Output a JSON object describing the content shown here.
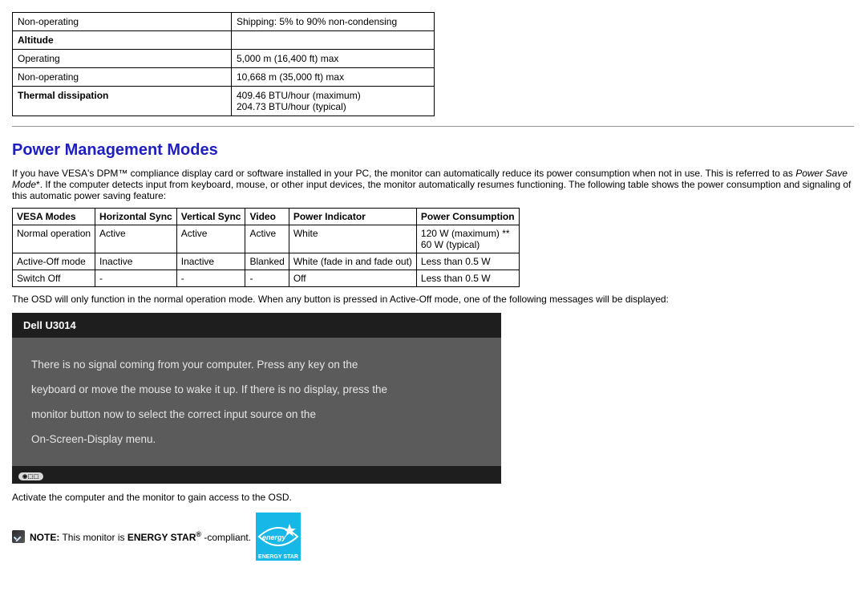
{
  "spec_table": {
    "rows": [
      {
        "label": "Non-operating",
        "value": "Shipping: 5% to 90% non-condensing",
        "boldLabel": false
      },
      {
        "label": "Altitude",
        "value": "",
        "boldLabel": true
      },
      {
        "label": "Operating",
        "value": "5,000 m (16,400 ft) max",
        "boldLabel": false
      },
      {
        "label": "Non-operating",
        "value": "10,668 m (35,000 ft) max",
        "boldLabel": false
      },
      {
        "label": "Thermal dissipation",
        "value": "409.46 BTU/hour (maximum)\n204.73 BTU/hour (typical)",
        "boldLabel": true
      }
    ]
  },
  "section_heading": "Power Management Modes",
  "intro_part1": "If you have VESA's DPM™ compliance display card or software installed in your PC, the monitor can automatically reduce its power consumption when not in use. This is referred to as ",
  "intro_italic": "Power Save Mode",
  "intro_part2": "*. If the computer detects input from keyboard, mouse, or other input devices, the monitor automatically resumes functioning. The following table shows the power consumption and signaling of this automatic power saving feature:",
  "power_table": {
    "headers": [
      "VESA Modes",
      "Horizontal Sync",
      "Vertical Sync",
      "Video",
      "Power Indicator",
      "Power Consumption"
    ],
    "rows": [
      [
        "Normal operation",
        "Active",
        "Active",
        "Active",
        "White",
        "120 W (maximum) **\n60 W (typical)"
      ],
      [
        "Active-Off mode",
        "Inactive",
        "Inactive",
        "Blanked",
        "White (fade in and fade out)",
        "Less than 0.5 W"
      ],
      [
        "Switch Off",
        "-",
        "-",
        "-",
        "Off",
        "Less than 0.5 W"
      ]
    ]
  },
  "osd_note": "The OSD will only function in the normal operation mode. When any button is pressed in Active-Off mode, one of the following messages will be displayed:",
  "osd_box": {
    "title": "Dell U3014",
    "line1": "There is no signal coming from your computer. Press any key on the",
    "line2": "keyboard or move the mouse to wake it up. If there is no display, press the",
    "line3": "monitor button now to select the correct input source on the",
    "line4": "On-Screen-Display menu.",
    "source_icon_label": "◉⬚⬚"
  },
  "activate_text": "Activate the computer and the monitor to gain access to the OSD.",
  "energy_star": {
    "note_prefix": "NOTE:",
    "text_part1": " This monitor is ",
    "text_bold": "ENERGY STAR",
    "reg": "®",
    "text_part2": " -compliant.",
    "label": "ENERGY STAR"
  }
}
